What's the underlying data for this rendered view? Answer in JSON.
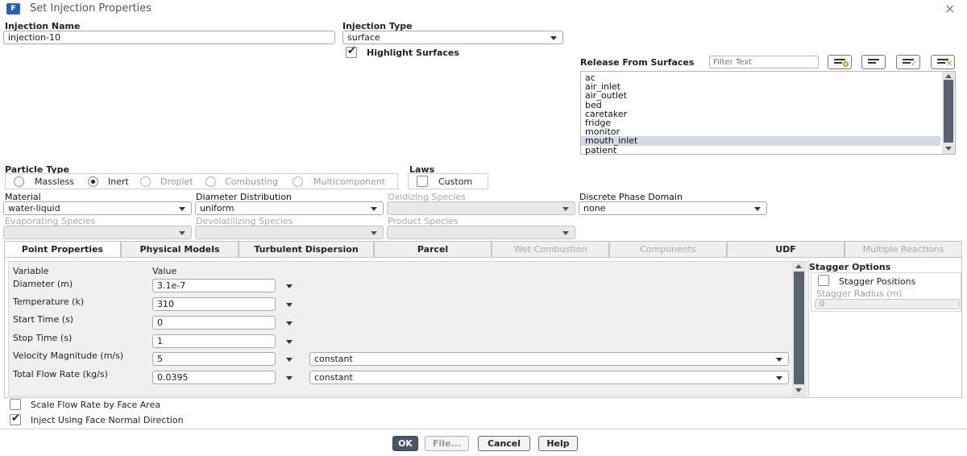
{
  "dialog": {
    "title": "Set Injection Properties",
    "app_icon_letter": "F"
  },
  "injection_name": {
    "label": "Injection Name",
    "value": "injection-10"
  },
  "injection_type": {
    "label": "Injection Type",
    "value": "surface"
  },
  "highlight_surfaces": {
    "label": "Highlight Surfaces",
    "checked": true
  },
  "release_from": {
    "label": "Release From Surfaces",
    "filter_placeholder": "Filter Text",
    "items": [
      "ac",
      "air_inlet",
      "air_outlet",
      "bed",
      "caretaker",
      "fridge",
      "monitor",
      "mouth_inlet",
      "patient"
    ],
    "selected": "mouth_inlet"
  },
  "particle_type": {
    "label": "Particle Type",
    "options": [
      "Massless",
      "Inert",
      "Droplet",
      "Combusting",
      "Multicomponent"
    ],
    "selected": "Inert"
  },
  "laws": {
    "label": "Laws",
    "custom_label": "Custom"
  },
  "material": {
    "label": "Material",
    "value": "water-liquid"
  },
  "diameter_distribution": {
    "label": "Diameter Distribution",
    "value": "uniform"
  },
  "oxidizing_species": {
    "label": "Oxidizing Species",
    "value": ""
  },
  "discrete_phase_domain": {
    "label": "Discrete Phase Domain",
    "value": "none"
  },
  "evaporating_species": {
    "label": "Evaporating Species",
    "value": ""
  },
  "devolatilizing_species": {
    "label": "Devolatilizing Species",
    "value": ""
  },
  "product_species": {
    "label": "Product Species",
    "value": ""
  },
  "tabs": [
    "Point Properties",
    "Physical Models",
    "Turbulent Dispersion",
    "Parcel",
    "Wet Combustion",
    "Components",
    "UDF",
    "Multiple Reactions"
  ],
  "active_tab": "Point Properties",
  "point_properties": {
    "col_variable": "Variable",
    "col_value": "Value",
    "rows": [
      {
        "name": "Diameter (m)",
        "value": "3.1e-7",
        "profile": ""
      },
      {
        "name": "Temperature (k)",
        "value": "310",
        "profile": ""
      },
      {
        "name": "Start Time (s)",
        "value": "0",
        "profile": ""
      },
      {
        "name": "Stop Time (s)",
        "value": "1",
        "profile": ""
      },
      {
        "name": "Velocity Magnitude (m/s)",
        "value": "5",
        "profile": "constant"
      },
      {
        "name": "Total Flow Rate (kg/s)",
        "value": "0.0395",
        "profile": "constant"
      }
    ]
  },
  "stagger": {
    "title": "Stagger Options",
    "positions_label": "Stagger Positions",
    "radius_label": "Stagger Radius (m)",
    "radius_value": "0"
  },
  "scale_flow": {
    "label": "Scale Flow Rate by Face Area",
    "checked": false
  },
  "inject_normal": {
    "label": "Inject Using Face Normal Direction",
    "checked": true
  },
  "buttons": {
    "ok": "OK",
    "file": "File...",
    "cancel": "Cancel",
    "help": "Help"
  },
  "colors": {
    "ok_bg": "#4a5568",
    "selection": "#d4d9e4",
    "tab_bg": "#efefef"
  }
}
